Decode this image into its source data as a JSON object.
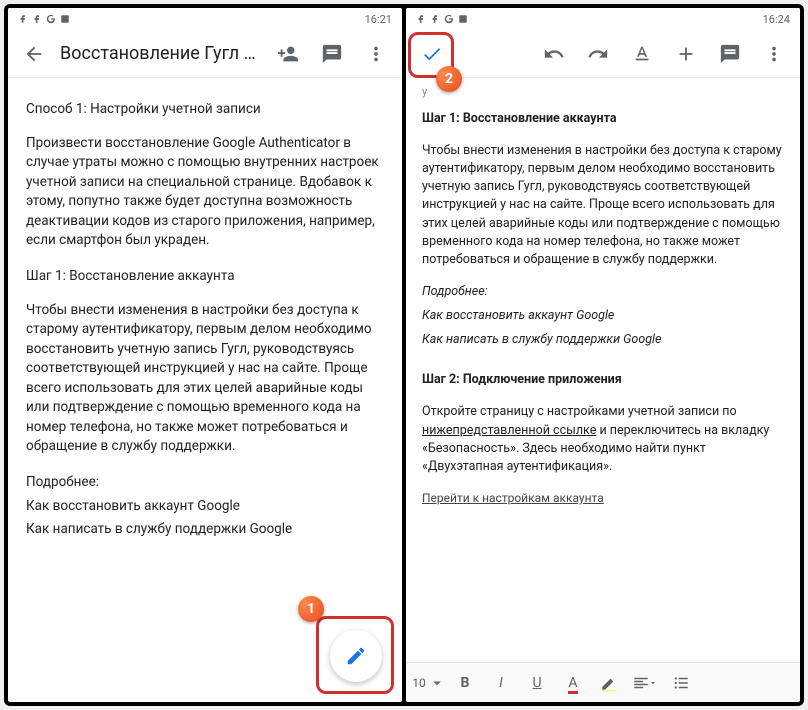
{
  "left": {
    "statusbar": {
      "time": "16:21"
    },
    "appbar": {
      "title": "Восстановление Гугл А..."
    },
    "content": {
      "heading": "Способ 1: Настройки учетной записи",
      "para1": "Произвести восстановление Google Authenticator в случае утраты можно с помощью внутренних настроек учетной записи на специальной странице. Вдобавок к этому, попутно также будет доступна возможность деактивации кодов из старого приложения, например, если смартфон был украден.",
      "step1": "Шаг 1: Восстановление аккаунта",
      "para2": "Чтобы внести изменения в настройки без доступа к старому аутентификатору, первым делом необходимо восстановить учетную запись Гугл, руководствуясь соответствующей инструкцией у нас на сайте. Проще всего использовать для этих целей аварийные коды или подтверждение с помощью временного кода на номер телефона, но также может потребоваться и обращение в службу поддержки.",
      "more": "Подробнее:",
      "link1": "Как восстановить аккаунт Google",
      "link2": "Как написать в службу поддержки Google"
    },
    "callout_num": "1"
  },
  "right": {
    "statusbar": {
      "time": "16:24"
    },
    "content": {
      "cut": "у",
      "h1": "Шаг 1: Восстановление аккаунта",
      "para1": "Чтобы внести изменения в настройки без доступа к старому аутентификатору, первым делом необходимо восстановить учетную запись Гугл, руководствуясь соответствующей инструкцией у нас на сайте. Проще всего использовать для этих целей аварийные коды или подтверждение с помощью временного кода на номер телефона, но также может потребоваться и обращение в службу поддержки.",
      "more": "Подробнее:",
      "link1": "Как восстановить аккаунт Google",
      "link2": "Как написать в службу поддержки Google",
      "h2": "Шаг 2: Подключение приложения",
      "para2a": "Откройте страницу с настройками учетной записи по ",
      "para2b": "нижепредставленной ссылке",
      "para2c": " и переключитесь на вкладку «Безопасность». Здесь необходимо найти пункт «Двухэтапная аутентификация».",
      "gotolink": "Перейти к настройкам аккаунта"
    },
    "toolbar": {
      "fontsize": "10"
    },
    "callout_num": "2"
  }
}
